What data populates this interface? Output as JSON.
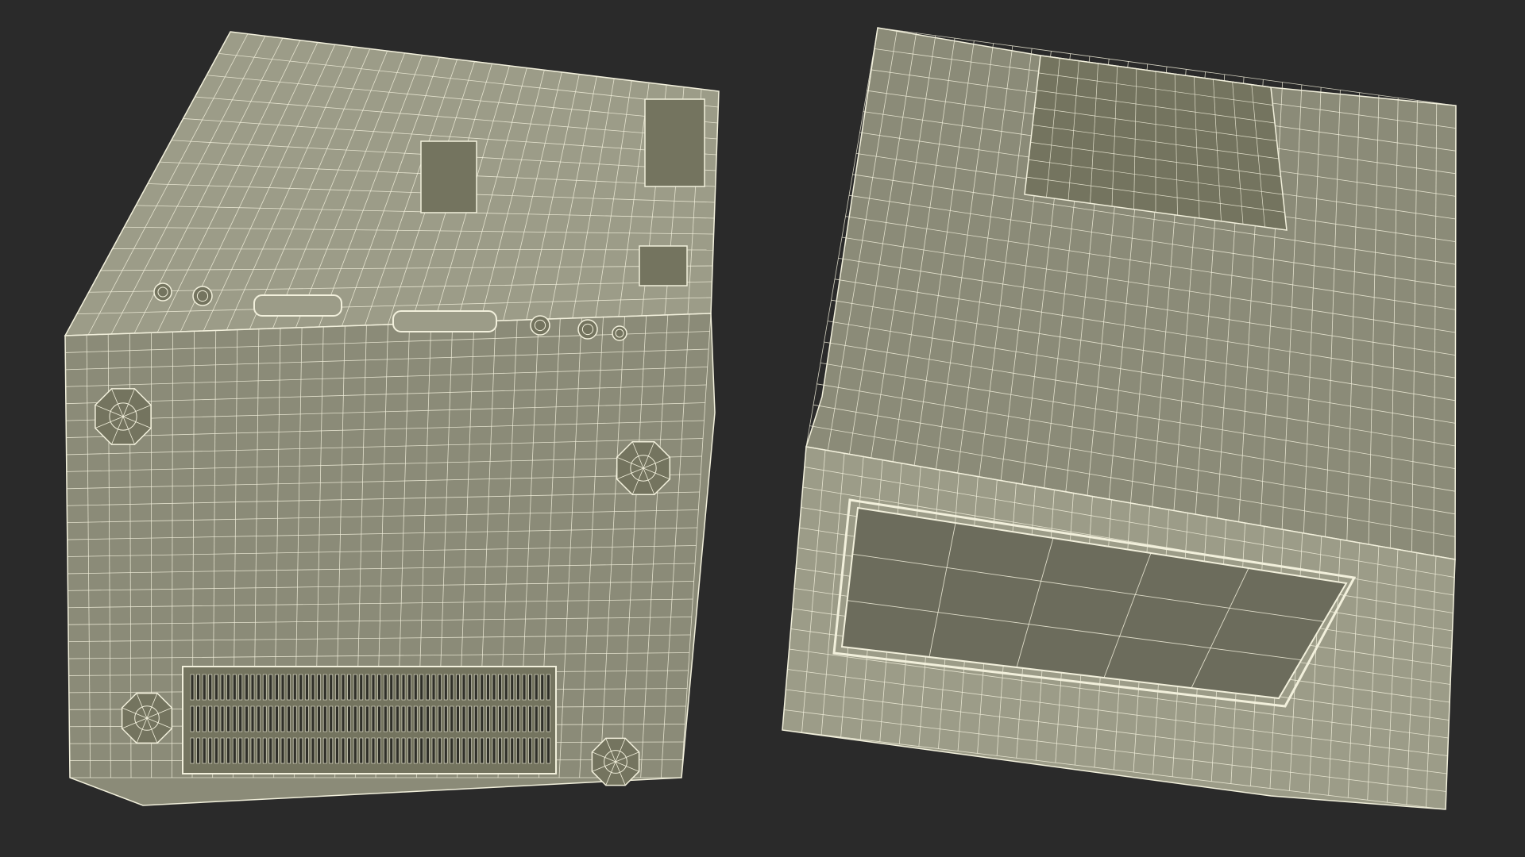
{
  "scene": {
    "background_color": "#2a2a2a",
    "model_fill": "#8b8b78",
    "model_fill_dark": "#74745f",
    "model_fill_light": "#9c9c88",
    "wire_color": "#f2f0dc",
    "screen_fill": "#6c6c5c",
    "vent_fill": "#2f2f28"
  },
  "views": [
    {
      "label": "",
      "subject": "computer-monitor-rear-wireframe"
    },
    {
      "label": "",
      "subject": "computer-monitor-front-wireframe"
    }
  ]
}
